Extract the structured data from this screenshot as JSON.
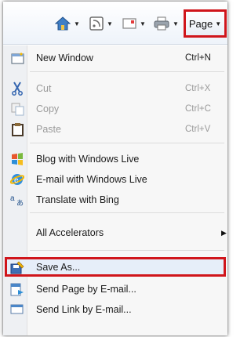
{
  "toolbar": {
    "home_icon": "home-icon",
    "feeds_icon": "feeds-icon",
    "mail_icon": "read-mail-icon",
    "print_icon": "print-icon",
    "page_label": "Page"
  },
  "menu": {
    "new_window": {
      "label": "New Window",
      "shortcut": "Ctrl+N",
      "icon": "new-window-icon"
    },
    "cut": {
      "label": "Cut",
      "shortcut": "Ctrl+X",
      "icon": "scissors-icon",
      "disabled": true
    },
    "copy": {
      "label": "Copy",
      "shortcut": "Ctrl+C",
      "icon": "copy-icon",
      "disabled": true
    },
    "paste": {
      "label": "Paste",
      "shortcut": "Ctrl+V",
      "icon": "clipboard-icon",
      "disabled": true
    },
    "blog": {
      "label": "Blog with Windows Live",
      "icon": "windows-live-icon"
    },
    "email_live": {
      "label": "E-mail with Windows Live",
      "icon": "ie-mail-icon"
    },
    "translate": {
      "label": "Translate with Bing",
      "icon": "translate-icon"
    },
    "accelerators": {
      "label": "All Accelerators"
    },
    "save_as": {
      "label": "Save As...",
      "icon": "save-as-icon"
    },
    "send_page": {
      "label": "Send Page by E-mail...",
      "icon": "send-page-icon"
    },
    "send_link": {
      "label": "Send Link by E-mail...",
      "icon": "send-link-icon"
    }
  },
  "colors": {
    "highlight_border": "#d0151b",
    "disabled_text": "#9a9a9a"
  }
}
